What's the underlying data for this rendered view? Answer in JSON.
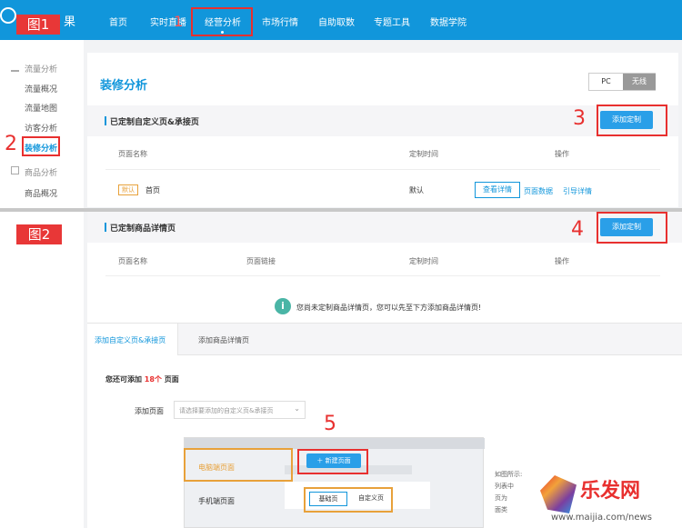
{
  "labels": {
    "fig1": "图1",
    "fig2": "图2",
    "n1": "1",
    "n2": "2",
    "n3": "3",
    "n4": "4",
    "n5": "5"
  },
  "nav": {
    "logo_text": "果",
    "items": [
      "首页",
      "实时直播",
      "经营分析",
      "市场行情",
      "自助取数",
      "专题工具",
      "数据学院"
    ]
  },
  "sidebar": {
    "group1": "流量分析",
    "items1": [
      "流量概况",
      "流量地图",
      "访客分析",
      "装修分析"
    ],
    "group2": "商品分析",
    "items2": [
      "商品概况"
    ]
  },
  "main": {
    "title": "装修分析",
    "toggle": {
      "pc": "PC",
      "wireless": "无线"
    },
    "custom_pages": {
      "title": "已定制自定义页&承接页",
      "add_label": "添加定制",
      "columns": [
        "页面名称",
        "定制时间",
        "操作"
      ],
      "row": {
        "badge": "默认",
        "name": "首页",
        "time": "默认",
        "view": "查看详情",
        "page_data": "页面数据",
        "guide_data": "引导详情"
      }
    },
    "detail_pages": {
      "title": "已定制商品详情页",
      "add_label": "添加定制",
      "columns": [
        "页面名称",
        "页面链接",
        "定制时间",
        "操作"
      ],
      "empty": "您尚未定制商品详情页，您可以先至下方添加商品详情页!"
    },
    "tabs": [
      "添加自定义页&承接页",
      "添加商品详情页"
    ],
    "remaining": {
      "prefix": "您还可添加",
      "count": "18个",
      "suffix": "页面"
    },
    "add_page": {
      "label": "添加页面",
      "placeholder": "请选择要添加的自定义页&承接页"
    },
    "preview": {
      "left_items": [
        "电脑端页面",
        "手机端页面"
      ],
      "new_page": "新建页面",
      "tabs": [
        "基础页",
        "自定义页"
      ],
      "side_text": [
        "如图所示:",
        "列表中",
        "页为",
        "面类"
      ]
    }
  },
  "watermark": {
    "logo": "乐发网",
    "url": "www.maijia.com/news"
  },
  "colors": {
    "nav": "#1196db",
    "accent_red": "#e8302f",
    "button": "#2a9fe8",
    "orange": "#e8a13a"
  }
}
